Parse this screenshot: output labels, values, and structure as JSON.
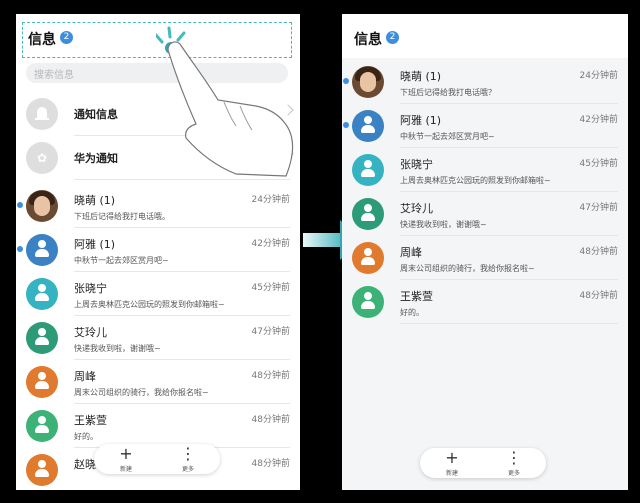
{
  "left": {
    "header": {
      "title": "信息",
      "badge": "2"
    },
    "search": {
      "placeholder": "搜索信息"
    },
    "system_items": [
      {
        "label": "通知信息",
        "icon": "bell-icon"
      },
      {
        "label": "华为通知",
        "icon": "huawei-flower-icon"
      }
    ],
    "conversations": [
      {
        "name": "晓萌 (1)",
        "preview": "下班后记得给我打电话哦。",
        "time": "24分钟前",
        "unread": true,
        "avatar": "photo",
        "color": "#6b4a32"
      },
      {
        "name": "阿雅 (1)",
        "preview": "中秋节一起去郊区赏月吧~",
        "time": "42分钟前",
        "unread": true,
        "avatar": "person",
        "color": "#3b82c4"
      },
      {
        "name": "张晓宁",
        "preview": "上周去奥林匹克公园玩的照发到你邮箱啦~",
        "time": "45分钟前",
        "unread": false,
        "avatar": "person",
        "color": "#36b3c2"
      },
      {
        "name": "艾玲儿",
        "preview": "快递我收到啦，谢谢哦~",
        "time": "47分钟前",
        "unread": false,
        "avatar": "person",
        "color": "#2e9b78"
      },
      {
        "name": "周峰",
        "preview": "周末公司组织的骑行，我给你报名啦~",
        "time": "48分钟前",
        "unread": false,
        "avatar": "person",
        "color": "#e07a2e"
      },
      {
        "name": "王紫萱",
        "preview": "好的。",
        "time": "48分钟前",
        "unread": false,
        "avatar": "person",
        "color": "#3cb277"
      },
      {
        "name": "赵晓",
        "preview": "",
        "time": "48分钟前",
        "unread": false,
        "avatar": "person",
        "color": "#e07a2e"
      }
    ],
    "fab": {
      "new_label": "新建",
      "more_label": "更多"
    }
  },
  "right": {
    "header": {
      "title": "信息",
      "badge": "2"
    },
    "conversations": [
      {
        "name": "晓萌 (1)",
        "preview": "下班后记得给我打电话哦？",
        "time": "24分钟前",
        "unread": true,
        "avatar": "photo",
        "color": "#6b4a32"
      },
      {
        "name": "阿雅 (1)",
        "preview": "中秋节一起去郊区赏月吧~",
        "time": "42分钟前",
        "unread": true,
        "avatar": "person",
        "color": "#3b82c4"
      },
      {
        "name": "张晓宁",
        "preview": "上周去奥林匹克公园玩的照发到你邮箱啦~",
        "time": "45分钟前",
        "unread": false,
        "avatar": "person",
        "color": "#36b3c2"
      },
      {
        "name": "艾玲儿",
        "preview": "快递我收到啦，谢谢哦~",
        "time": "47分钟前",
        "unread": false,
        "avatar": "person",
        "color": "#2e9b78"
      },
      {
        "name": "周峰",
        "preview": "周末公司组织的骑行，我给你报名啦~",
        "time": "48分钟前",
        "unread": false,
        "avatar": "person",
        "color": "#e07a2e"
      },
      {
        "name": "王紫萱",
        "preview": "好的。",
        "time": "48分钟前",
        "unread": false,
        "avatar": "person",
        "color": "#3cb277"
      }
    ],
    "fab": {
      "new_label": "新建",
      "more_label": "更多"
    }
  },
  "colors": {
    "accent": "#3d8fdd",
    "highlight": "#47b9bd",
    "arrow": "#2fa7b0"
  }
}
